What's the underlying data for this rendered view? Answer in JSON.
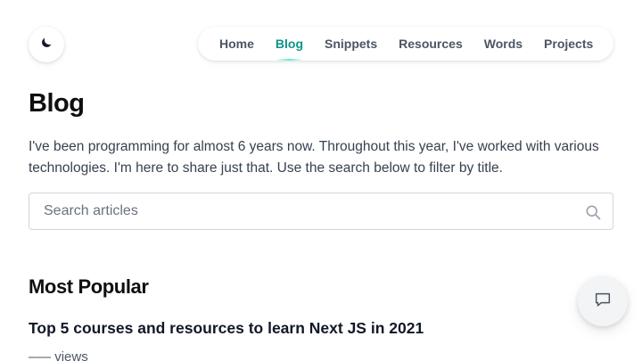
{
  "header": {
    "theme_toggle_icon": "moon-icon",
    "nav": [
      {
        "label": "Home",
        "active": false
      },
      {
        "label": "Blog",
        "active": true
      },
      {
        "label": "Snippets",
        "active": false
      },
      {
        "label": "Resources",
        "active": false
      },
      {
        "label": "Words",
        "active": false
      },
      {
        "label": "Projects",
        "active": false
      }
    ]
  },
  "main": {
    "title": "Blog",
    "intro": "I've been programming for almost 6 years now. Throughout this year, I've worked with various technologies. I'm here to share just that. Use the search below to filter by title.",
    "search": {
      "placeholder": "Search articles",
      "value": "",
      "icon": "search-icon"
    },
    "popular": {
      "heading": "Most Popular",
      "posts": [
        {
          "title": "Top 5 courses and resources to learn Next JS in 2021",
          "views": "––– views"
        }
      ]
    }
  },
  "chat": {
    "icon": "chat-icon"
  },
  "colors": {
    "accent": "#0d9488",
    "text": "#111827",
    "muted": "#4b5563"
  }
}
